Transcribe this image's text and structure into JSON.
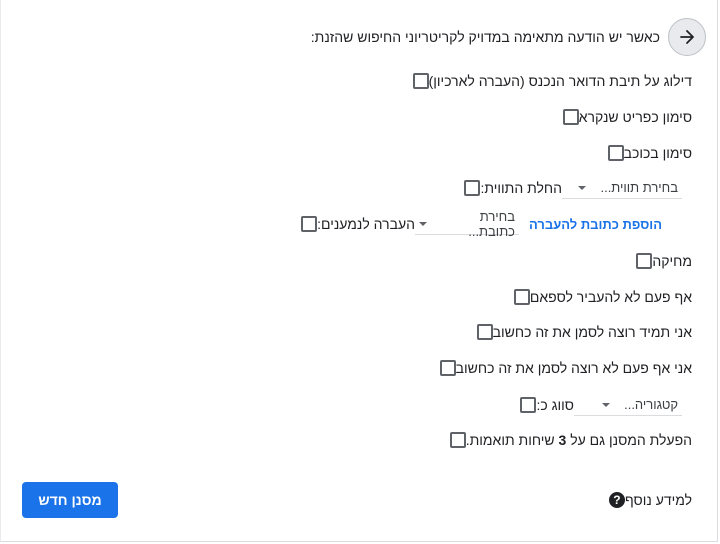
{
  "header": {
    "text": "כאשר יש הודעה מתאימה במדויק לקריטריוני החיפוש שהזנת:",
    "back_icon": "arrow-right-icon"
  },
  "options": {
    "skip_inbox": "דילוג על תיבת הדואר הנכנס (העברה לארכיון)",
    "mark_read": "סימון כפריט שנקרא",
    "star": "סימון בכוכב",
    "apply_label": "החלת התווית:",
    "apply_label_select": "בחירת תווית...",
    "forward": "העברה לנמענים:",
    "forward_select": "בחירת כתובת...",
    "add_forward_link": "הוספת כתובת להעברה",
    "delete": "מחיקה",
    "never_spam": "אף פעם לא להעביר לספאם",
    "always_important": "אני תמיד רוצה לסמן את זה כחשוב",
    "never_important": "אני אף פעם לא רוצה לסמן את זה כחשוב",
    "categorize": "סווג כ:",
    "categorize_select": "קטגוריה...",
    "apply_existing_prefix": "הפעלת המסנן גם על",
    "apply_existing_count": "3",
    "apply_existing_suffix": "שיחות תואמות."
  },
  "footer": {
    "learn_more": "למידע נוסף",
    "create_filter": "מסנן חדש"
  }
}
